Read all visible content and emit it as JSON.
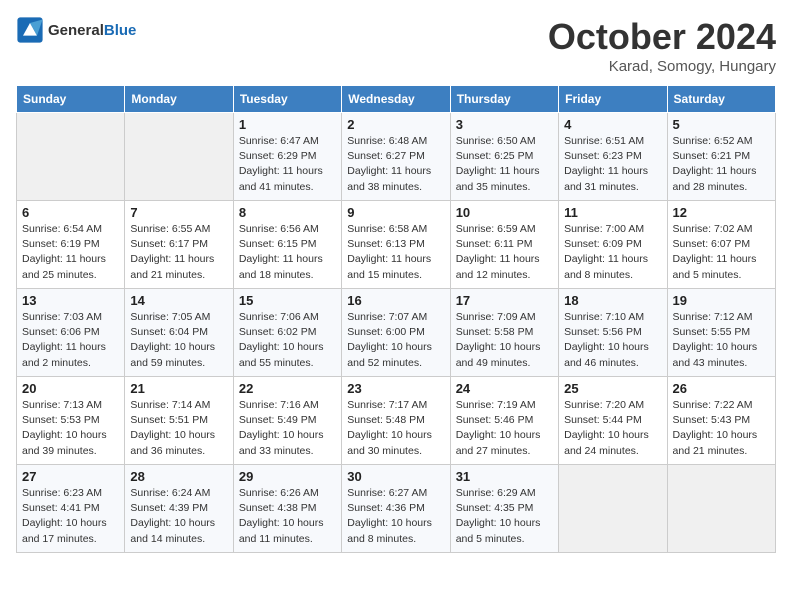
{
  "header": {
    "logo_line1": "General",
    "logo_line2": "Blue",
    "month": "October 2024",
    "location": "Karad, Somogy, Hungary"
  },
  "days_of_week": [
    "Sunday",
    "Monday",
    "Tuesday",
    "Wednesday",
    "Thursday",
    "Friday",
    "Saturday"
  ],
  "weeks": [
    [
      {
        "num": "",
        "info": ""
      },
      {
        "num": "",
        "info": ""
      },
      {
        "num": "1",
        "info": "Sunrise: 6:47 AM\nSunset: 6:29 PM\nDaylight: 11 hours and 41 minutes."
      },
      {
        "num": "2",
        "info": "Sunrise: 6:48 AM\nSunset: 6:27 PM\nDaylight: 11 hours and 38 minutes."
      },
      {
        "num": "3",
        "info": "Sunrise: 6:50 AM\nSunset: 6:25 PM\nDaylight: 11 hours and 35 minutes."
      },
      {
        "num": "4",
        "info": "Sunrise: 6:51 AM\nSunset: 6:23 PM\nDaylight: 11 hours and 31 minutes."
      },
      {
        "num": "5",
        "info": "Sunrise: 6:52 AM\nSunset: 6:21 PM\nDaylight: 11 hours and 28 minutes."
      }
    ],
    [
      {
        "num": "6",
        "info": "Sunrise: 6:54 AM\nSunset: 6:19 PM\nDaylight: 11 hours and 25 minutes."
      },
      {
        "num": "7",
        "info": "Sunrise: 6:55 AM\nSunset: 6:17 PM\nDaylight: 11 hours and 21 minutes."
      },
      {
        "num": "8",
        "info": "Sunrise: 6:56 AM\nSunset: 6:15 PM\nDaylight: 11 hours and 18 minutes."
      },
      {
        "num": "9",
        "info": "Sunrise: 6:58 AM\nSunset: 6:13 PM\nDaylight: 11 hours and 15 minutes."
      },
      {
        "num": "10",
        "info": "Sunrise: 6:59 AM\nSunset: 6:11 PM\nDaylight: 11 hours and 12 minutes."
      },
      {
        "num": "11",
        "info": "Sunrise: 7:00 AM\nSunset: 6:09 PM\nDaylight: 11 hours and 8 minutes."
      },
      {
        "num": "12",
        "info": "Sunrise: 7:02 AM\nSunset: 6:07 PM\nDaylight: 11 hours and 5 minutes."
      }
    ],
    [
      {
        "num": "13",
        "info": "Sunrise: 7:03 AM\nSunset: 6:06 PM\nDaylight: 11 hours and 2 minutes."
      },
      {
        "num": "14",
        "info": "Sunrise: 7:05 AM\nSunset: 6:04 PM\nDaylight: 10 hours and 59 minutes."
      },
      {
        "num": "15",
        "info": "Sunrise: 7:06 AM\nSunset: 6:02 PM\nDaylight: 10 hours and 55 minutes."
      },
      {
        "num": "16",
        "info": "Sunrise: 7:07 AM\nSunset: 6:00 PM\nDaylight: 10 hours and 52 minutes."
      },
      {
        "num": "17",
        "info": "Sunrise: 7:09 AM\nSunset: 5:58 PM\nDaylight: 10 hours and 49 minutes."
      },
      {
        "num": "18",
        "info": "Sunrise: 7:10 AM\nSunset: 5:56 PM\nDaylight: 10 hours and 46 minutes."
      },
      {
        "num": "19",
        "info": "Sunrise: 7:12 AM\nSunset: 5:55 PM\nDaylight: 10 hours and 43 minutes."
      }
    ],
    [
      {
        "num": "20",
        "info": "Sunrise: 7:13 AM\nSunset: 5:53 PM\nDaylight: 10 hours and 39 minutes."
      },
      {
        "num": "21",
        "info": "Sunrise: 7:14 AM\nSunset: 5:51 PM\nDaylight: 10 hours and 36 minutes."
      },
      {
        "num": "22",
        "info": "Sunrise: 7:16 AM\nSunset: 5:49 PM\nDaylight: 10 hours and 33 minutes."
      },
      {
        "num": "23",
        "info": "Sunrise: 7:17 AM\nSunset: 5:48 PM\nDaylight: 10 hours and 30 minutes."
      },
      {
        "num": "24",
        "info": "Sunrise: 7:19 AM\nSunset: 5:46 PM\nDaylight: 10 hours and 27 minutes."
      },
      {
        "num": "25",
        "info": "Sunrise: 7:20 AM\nSunset: 5:44 PM\nDaylight: 10 hours and 24 minutes."
      },
      {
        "num": "26",
        "info": "Sunrise: 7:22 AM\nSunset: 5:43 PM\nDaylight: 10 hours and 21 minutes."
      }
    ],
    [
      {
        "num": "27",
        "info": "Sunrise: 6:23 AM\nSunset: 4:41 PM\nDaylight: 10 hours and 17 minutes."
      },
      {
        "num": "28",
        "info": "Sunrise: 6:24 AM\nSunset: 4:39 PM\nDaylight: 10 hours and 14 minutes."
      },
      {
        "num": "29",
        "info": "Sunrise: 6:26 AM\nSunset: 4:38 PM\nDaylight: 10 hours and 11 minutes."
      },
      {
        "num": "30",
        "info": "Sunrise: 6:27 AM\nSunset: 4:36 PM\nDaylight: 10 hours and 8 minutes."
      },
      {
        "num": "31",
        "info": "Sunrise: 6:29 AM\nSunset: 4:35 PM\nDaylight: 10 hours and 5 minutes."
      },
      {
        "num": "",
        "info": ""
      },
      {
        "num": "",
        "info": ""
      }
    ]
  ]
}
